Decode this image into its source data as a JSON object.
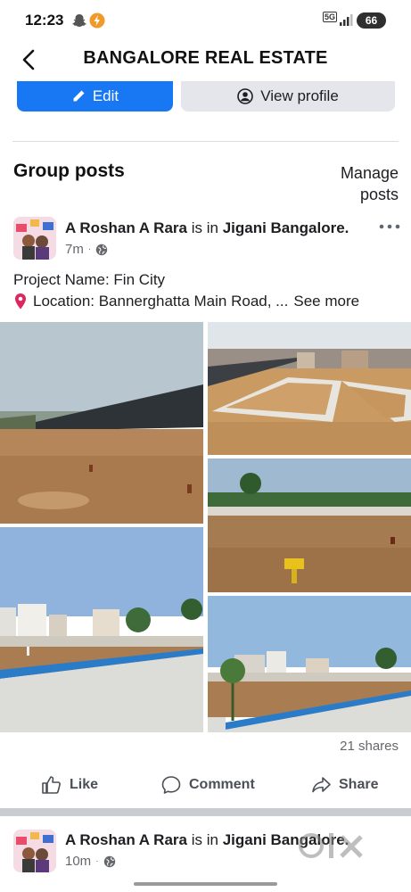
{
  "status_bar": {
    "time": "12:23",
    "network": "5G",
    "battery": "66"
  },
  "header": {
    "title": "BANGALORE REAL ESTATE"
  },
  "actions": {
    "edit_label": "Edit",
    "view_profile_label": "View profile"
  },
  "section": {
    "title": "Group posts",
    "manage_posts": "Manage posts"
  },
  "post": {
    "author": "A Roshan A Rara",
    "connector": "is in",
    "location": "Jigani Bangalore.",
    "time": "7m",
    "line1": "Project Name: Fin City",
    "line2": "Location: Bannerghatta Main Road, ...",
    "see_more": "See more",
    "shares": "21 shares",
    "photo_count": 5
  },
  "post_actions": {
    "like": "Like",
    "comment": "Comment",
    "share": "Share"
  },
  "next_post": {
    "author": "A Roshan A Rara",
    "connector": "is in",
    "location": "Jigani Bangalore.",
    "time": "10m"
  },
  "watermark": {
    "brand": "olx"
  },
  "colors": {
    "primary": "#1877f2",
    "secondary_button": "#e4e6eb",
    "meta_text": "#65676b",
    "divider": "#dadde1"
  }
}
